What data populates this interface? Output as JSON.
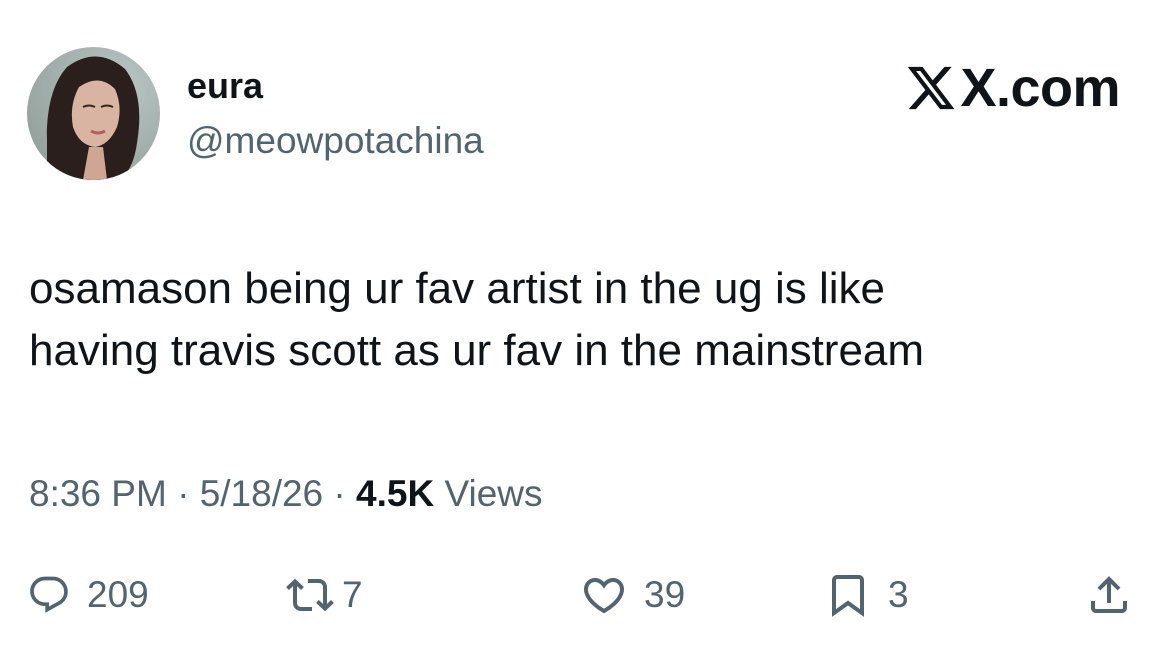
{
  "author": {
    "display_name": "eura",
    "handle": "@meowpotachina"
  },
  "brand": {
    "domain_label": "X.com",
    "icon": "x-logo-icon"
  },
  "tweet": {
    "text": "osamason being ur fav artist in the ug is like\nhaving travis scott as ur fav in the mainstream"
  },
  "meta": {
    "time": "8:36 PM",
    "separator": "·",
    "date": "5/18/26",
    "views_count": "4.5K",
    "views_label": "Views"
  },
  "actions": {
    "replies": {
      "icon": "reply-icon",
      "count": "209"
    },
    "reposts": {
      "icon": "repost-icon",
      "count": "7"
    },
    "likes": {
      "icon": "heart-icon",
      "count": "39"
    },
    "bookmarks": {
      "icon": "bookmark-icon",
      "count": "3"
    },
    "share": {
      "icon": "share-icon"
    }
  },
  "colors": {
    "text_primary": "#0f1419",
    "text_secondary": "#536471",
    "background": "#ffffff"
  }
}
